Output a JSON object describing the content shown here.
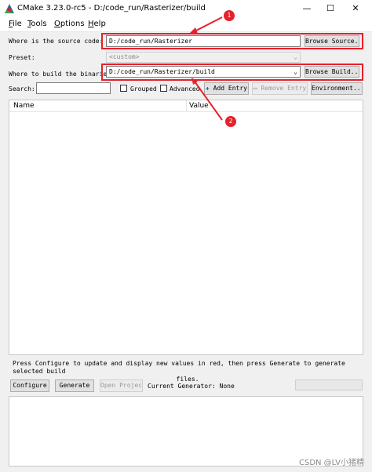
{
  "window": {
    "title": "CMake 3.23.0-rc5 - D:/code_run/Rasterizer/build",
    "minimize": "—",
    "maximize": "☐",
    "close": "✕"
  },
  "menu": [
    {
      "accel": "F",
      "rest": "ile"
    },
    {
      "accel": "T",
      "rest": "ools"
    },
    {
      "accel": "O",
      "rest": "ptions"
    },
    {
      "accel": "H",
      "rest": "elp"
    }
  ],
  "source": {
    "label": "Where is the source code:",
    "value": "D:/code_run/Rasterizer",
    "button": "Browse Source..."
  },
  "preset": {
    "label": "Preset:",
    "value": "<custom>"
  },
  "build": {
    "label": "Where to build the binaries:",
    "value": "D:/code_run/Rasterizer/build",
    "button": "Browse Build..."
  },
  "search": {
    "label": "Search:",
    "value": ""
  },
  "options": {
    "grouped": "Grouped",
    "advanced": "Advanced",
    "add_entry": "Add Entry",
    "remove_entry": "Remove Entry",
    "environment": "Environment..."
  },
  "table": {
    "col_name": "Name",
    "col_value": "Value"
  },
  "hint": {
    "line1": "Press Configure to update and display new values in red, then press Generate to generate selected build",
    "line2": "files."
  },
  "actions": {
    "configure": "Configure",
    "generate": "Generate",
    "open_project": "Open Project",
    "generator_label": "Current Generator: None"
  },
  "annotations": {
    "badge1": "1",
    "badge2": "2",
    "color": "#e8202a"
  },
  "watermark": "CSDN @LV小猪精"
}
